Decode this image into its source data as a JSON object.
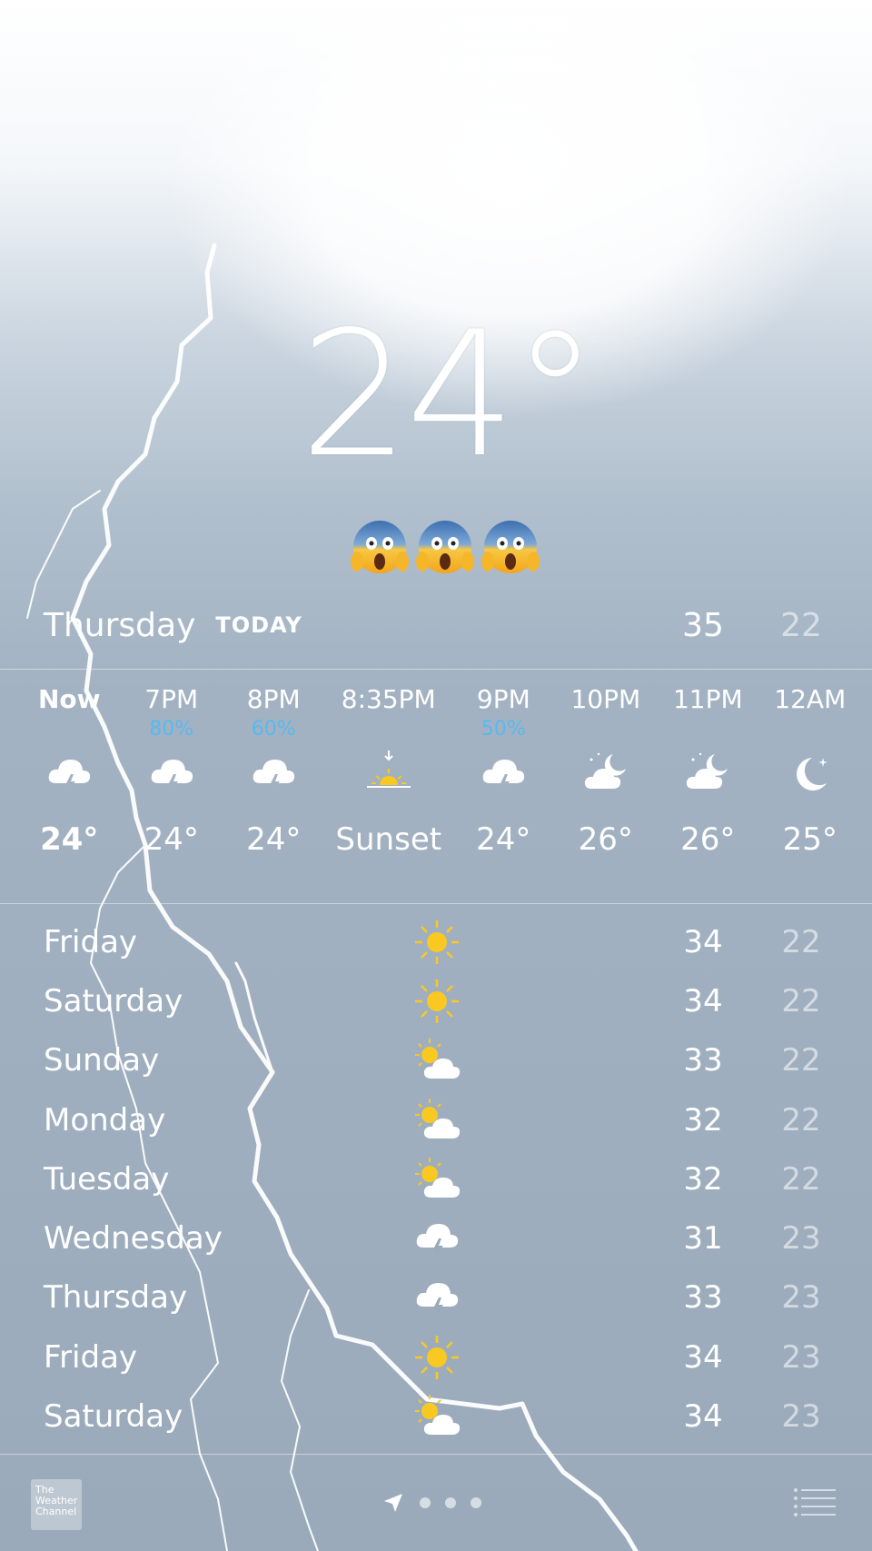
{
  "current": {
    "temperature": "24°",
    "condition_icon": "face-screaming-in-fear-emoji",
    "condition_icon_count": 3
  },
  "today": {
    "day": "Thursday",
    "tag": "TODAY",
    "high": "35",
    "low": "22"
  },
  "hourly": [
    {
      "time": "Now",
      "pop": "",
      "icon": "thunderstorm-icon",
      "temp": "24°",
      "bold": true
    },
    {
      "time": "7PM",
      "pop": "80%",
      "icon": "thunderstorm-icon",
      "temp": "24°"
    },
    {
      "time": "8PM",
      "pop": "60%",
      "icon": "thunderstorm-icon",
      "temp": "24°"
    },
    {
      "time": "8:35PM",
      "pop": "",
      "icon": "sunset-icon",
      "temp": "Sunset"
    },
    {
      "time": "9PM",
      "pop": "50%",
      "icon": "thunderstorm-icon",
      "temp": "24°"
    },
    {
      "time": "10PM",
      "pop": "",
      "icon": "partly-cloudy-night-icon",
      "temp": "26°"
    },
    {
      "time": "11PM",
      "pop": "",
      "icon": "partly-cloudy-night-icon",
      "temp": "26°"
    },
    {
      "time": "12AM",
      "pop": "",
      "icon": "clear-night-icon",
      "temp": "25°"
    }
  ],
  "daily": [
    {
      "day": "Friday",
      "icon": "sunny-icon",
      "high": "34",
      "low": "22"
    },
    {
      "day": "Saturday",
      "icon": "sunny-icon",
      "high": "34",
      "low": "22"
    },
    {
      "day": "Sunday",
      "icon": "partly-cloudy-icon",
      "high": "33",
      "low": "22"
    },
    {
      "day": "Monday",
      "icon": "partly-cloudy-icon",
      "high": "32",
      "low": "22"
    },
    {
      "day": "Tuesday",
      "icon": "partly-cloudy-icon",
      "high": "32",
      "low": "22"
    },
    {
      "day": "Wednesday",
      "icon": "thunderstorm-icon",
      "high": "31",
      "low": "23"
    },
    {
      "day": "Thursday",
      "icon": "thunderstorm-icon",
      "high": "33",
      "low": "23"
    },
    {
      "day": "Friday",
      "icon": "sunny-icon",
      "high": "34",
      "low": "23"
    },
    {
      "day": "Saturday",
      "icon": "partly-cloudy-icon",
      "high": "34",
      "low": "23"
    }
  ],
  "footer": {
    "logo_text": "The Weather Channel",
    "page_count": 3,
    "current_page": "location"
  },
  "colors": {
    "precip_blue": "#5ab8ef",
    "sun_yellow": "#f9c922",
    "low_temp_faded": "rgba(255,255,255,0.55)"
  }
}
